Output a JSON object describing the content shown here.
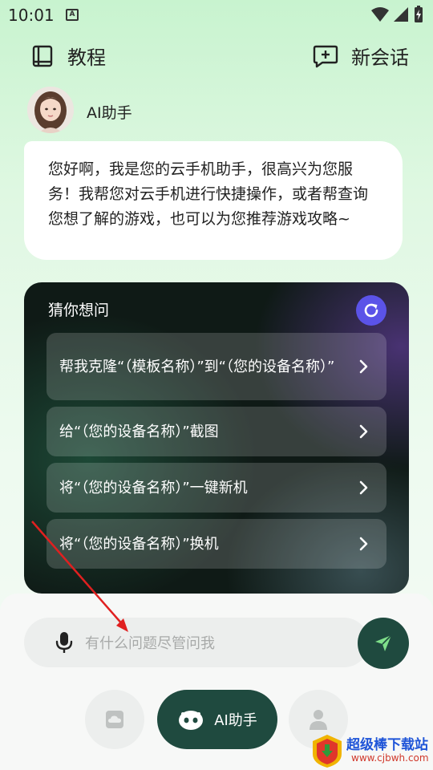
{
  "status_bar": {
    "time": "10:01"
  },
  "header": {
    "tutorial_label": "教程",
    "new_chat_label": "新会话"
  },
  "assistant": {
    "name": "AI助手",
    "greeting": "您好啊，我是您的云手机助手，很高兴为您服务！我帮您对云手机进行快捷操作，或者帮查询您想了解的游戏，也可以为您推荐游戏攻略~"
  },
  "suggestions": {
    "title": "猜你想问",
    "items": [
      {
        "text": "帮我克隆“（模板名称）”到“（您的设备名称）”"
      },
      {
        "text": "给“（您的设备名称）”截图"
      },
      {
        "text": "将“（您的设备名称）”一键新机"
      },
      {
        "text": "将“（您的设备名称）”换机"
      }
    ]
  },
  "input": {
    "placeholder": "有什么问题尽管问我"
  },
  "bottom_nav": {
    "ai_label": "AI助手"
  },
  "watermark": {
    "text": "超级棒下载站",
    "url": "www.cjbwh.com"
  },
  "colors": {
    "accent_dark_green": "#1f4a3f",
    "refresh_purple": "#5b53e8",
    "annotation_red": "#e02020"
  }
}
